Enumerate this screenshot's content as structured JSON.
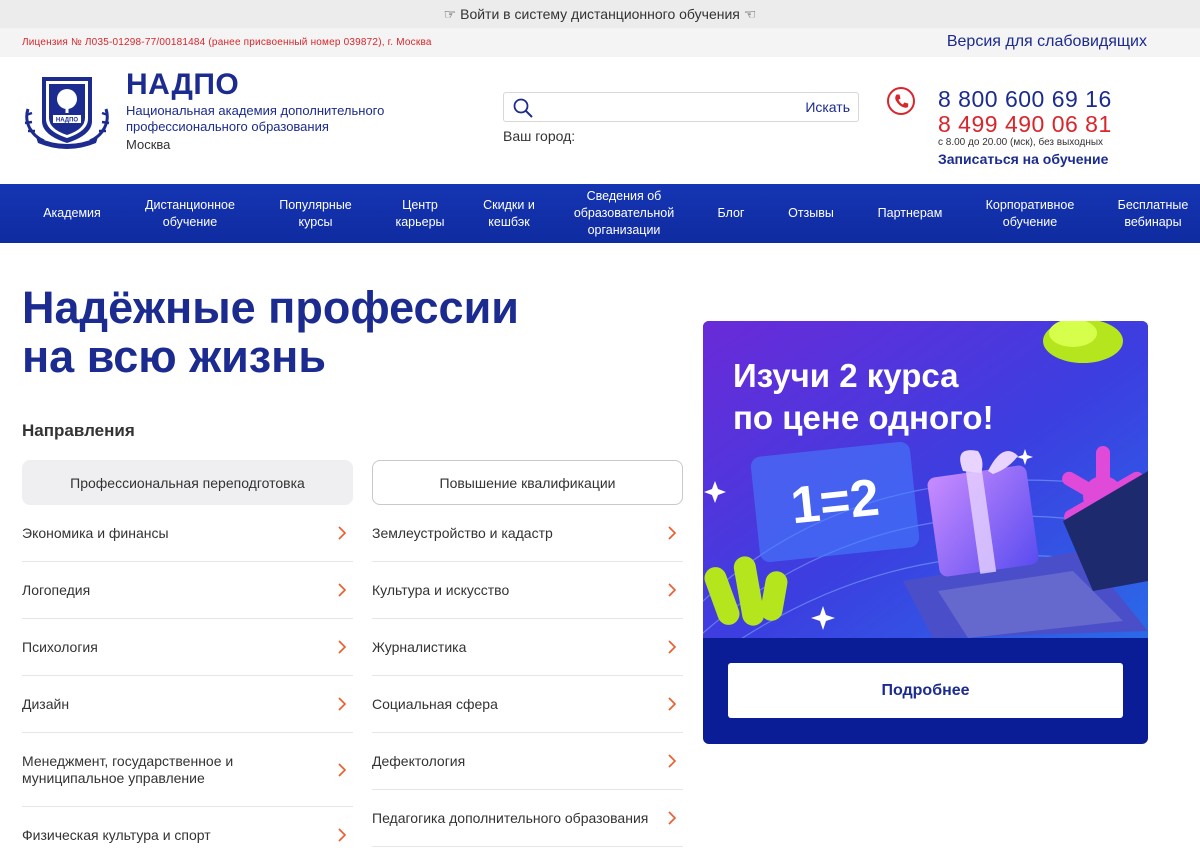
{
  "topbar": {
    "login_text": "☞ Войти в систему дистанционного обучения ☜"
  },
  "infobar": {
    "license": "Лицензия № Л035-01298-77/00181484 (ранее присвоенный номер 039872), г. Москва",
    "low_vision": "Версия для слабовидящих"
  },
  "header": {
    "logo_icon": "academy-emblem",
    "brand_name": "НАДПО",
    "brand_full": "Национальная академия дополнительного профессионального образования",
    "city": "Москва",
    "search": {
      "placeholder": "",
      "value": "",
      "button": "Искать"
    },
    "city_label": "Ваш город:",
    "phone_icon": "phone-icon",
    "phone_primary": "8 800 600 69 16",
    "phone_secondary": "8 499 490 06 81",
    "hours": "с 8.00 до 20.00 (мск), без выходных",
    "enroll": "Записаться на обучение"
  },
  "nav": {
    "items": [
      {
        "label": "Академия"
      },
      {
        "label": "Дистанционное обучение"
      },
      {
        "label": "Популярные курсы"
      },
      {
        "label": "Центр карьеры"
      },
      {
        "label": "Скидки и кешбэк"
      },
      {
        "label": "Сведения об образовательной организации"
      },
      {
        "label": "Блог"
      },
      {
        "label": "Отзывы"
      },
      {
        "label": "Партнерам"
      },
      {
        "label": "Корпоративное обучение"
      },
      {
        "label": "Бесплатные вебинары"
      }
    ]
  },
  "main": {
    "hero_title_line1": "Надёжные профессии",
    "hero_title_line2": "на всю жизнь",
    "directions_heading": "Направления",
    "tabs": [
      {
        "label": "Профессиональная переподготовка",
        "active": true
      },
      {
        "label": "Повышение квалификации",
        "active": false
      }
    ],
    "left_directions": [
      {
        "label": "Экономика и финансы"
      },
      {
        "label": "Логопедия"
      },
      {
        "label": "Психология"
      },
      {
        "label": "Дизайн"
      },
      {
        "label": "Менеджмент, государственное и муниципальное управление"
      },
      {
        "label": "Физическая культура и спорт"
      }
    ],
    "right_directions": [
      {
        "label": "Землеустройство и кадастр"
      },
      {
        "label": "Культура и искусство"
      },
      {
        "label": "Журналистика"
      },
      {
        "label": "Социальная сфера"
      },
      {
        "label": "Дефектология"
      },
      {
        "label": "Педагогика дополнительного образования"
      }
    ]
  },
  "promo": {
    "headline_line1": "Изучи 2 курса",
    "headline_line2": "по цене одного!",
    "badge": "1=2",
    "button": "Подробнее",
    "colors": {
      "primary": "#1b2b8f",
      "accent": "#d8262b",
      "chevron": "#f05a28"
    }
  }
}
